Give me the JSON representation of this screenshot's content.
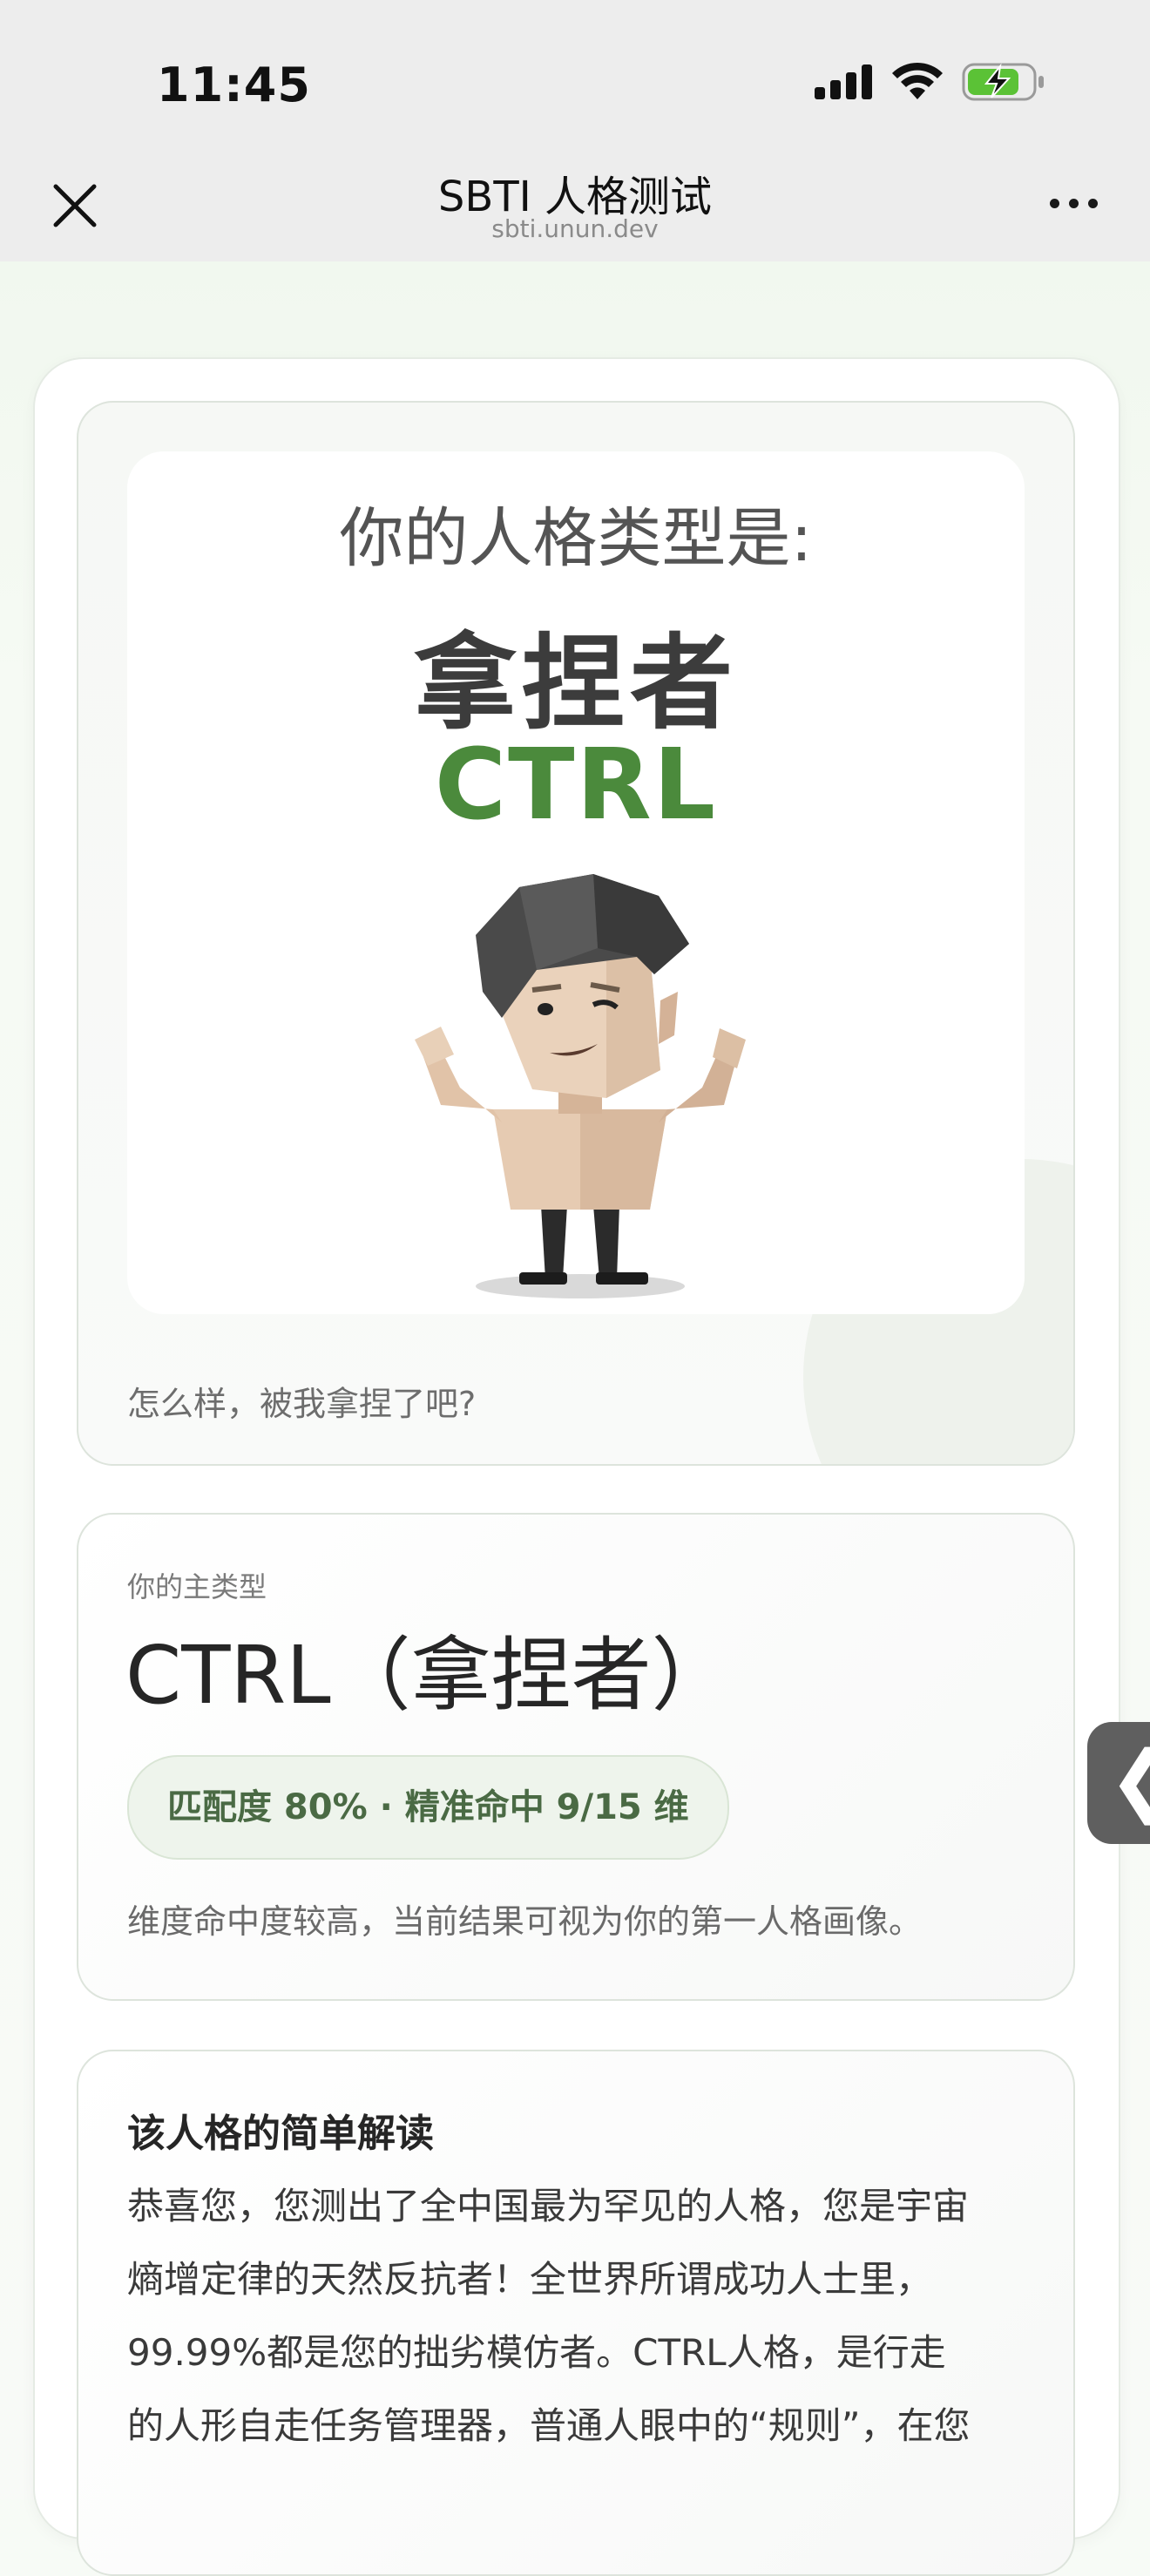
{
  "status": {
    "time": "11:45"
  },
  "nav": {
    "title": "SBTI 人格测试",
    "subtitle": "sbti.unun.dev",
    "close_icon": "close-icon",
    "more_icon": "more-icon"
  },
  "hero": {
    "heading": "你的人格类型是:",
    "name": "拿捏者",
    "code": "CTRL",
    "caption": "怎么样，被我拿捏了吧?"
  },
  "type_card": {
    "label": "你的主类型",
    "title": "CTRL（拿捏者）",
    "match": "匹配度 80% · 精准命中 9/15 维",
    "description": "维度命中度较高，当前结果可视为你的第一人格画像。"
  },
  "interpretation": {
    "title": "该人格的简单解读",
    "lines": [
      "恭喜您，您测出了全中国最为罕见的人格，您是宇宙",
      "熵增定律的天然反抗者！全世界所谓成功人士里，",
      "99.99%都是您的拙劣模仿者。CTRL人格，是行走",
      "的人形自走任务管理器，普通人眼中的“规则”，在您"
    ]
  },
  "side_tab": {
    "glyph": "❮"
  },
  "colors": {
    "accent_green": "#4b8a3c",
    "pill_bg": "#eef4ec",
    "bar_bg": "#ededed"
  }
}
